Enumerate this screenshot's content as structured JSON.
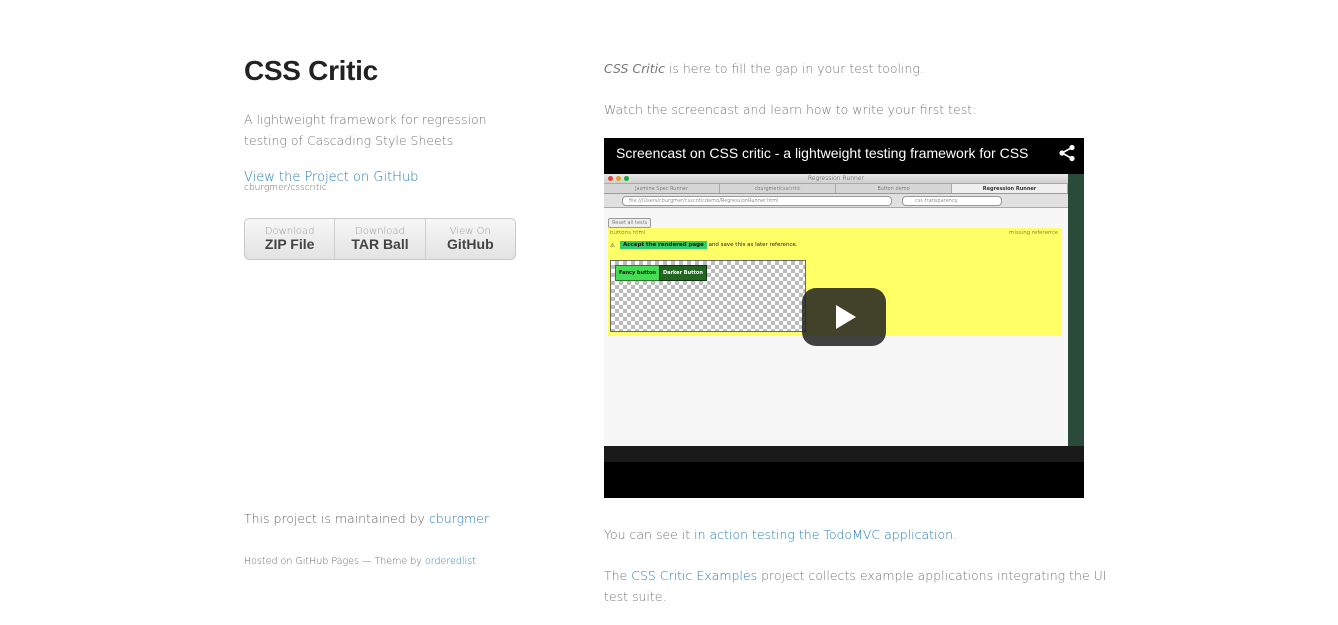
{
  "header": {
    "title": "CSS Critic",
    "tagline": "A lightweight framework for regression testing of Cascading Style Sheets",
    "github_link": "View the Project on GitHub",
    "repo": "cburgmer/csscritic"
  },
  "downloads": [
    {
      "top": "Download",
      "bottom": "ZIP File"
    },
    {
      "top": "Download",
      "bottom": "TAR Ball"
    },
    {
      "top": "View On",
      "bottom": "GitHub"
    }
  ],
  "footer": {
    "maintained_prefix": "This project is maintained by ",
    "maintainer": "cburgmer",
    "hosted_prefix": "Hosted on GitHub Pages — Theme by ",
    "theme_author": "orderedlist"
  },
  "content": {
    "intro_em": "CSS Critic",
    "intro_rest": " is here to fill the gap in your test tooling.",
    "watch": "Watch the screencast and learn how to write your first test:",
    "action_prefix": "You can see it ",
    "action_link": "in action testing the TodoMVC application",
    "action_suffix": ".",
    "examples_prefix": "The ",
    "examples_link": "CSS Critic Examples",
    "examples_suffix": " project collects example applications integrating the UI test suite."
  },
  "video": {
    "title": "Screencast on CSS critic - a lightweight testing framework for CSS",
    "window_title": "Regression Runner",
    "tabs": [
      "Jasmine Spec Runner",
      "cburgmer/csscritic",
      "Button demo",
      "Regression Runner"
    ],
    "url": "file:///Users/cburgmer/csscriticdemo/RegressionRunner.html",
    "search": "css transparency",
    "reset_button": "Reset all tests",
    "test_file": "buttons.html",
    "missing": "missing reference",
    "accept_label": "Accept the rendered page",
    "accept_rest": "and save this as later reference.",
    "fancy_button": "Fancy button",
    "darker_button": "Darker Button"
  },
  "colors": {
    "link": "#267CB9",
    "title": "#222222",
    "body_text": "#777777"
  }
}
